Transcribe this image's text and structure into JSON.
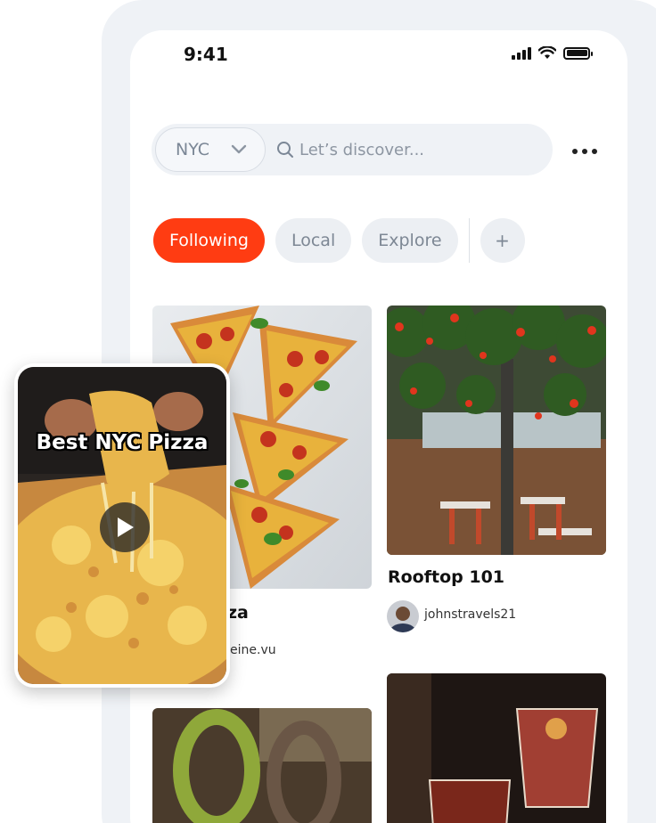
{
  "status_bar": {
    "time": "9:41"
  },
  "search": {
    "city": "NYC",
    "placeholder": "Let’s discover..."
  },
  "tabs": [
    {
      "label": "Following",
      "active": true
    },
    {
      "label": "Local",
      "active": false
    },
    {
      "label": "Explore",
      "active": false
    },
    {
      "label": "+",
      "active": false
    }
  ],
  "feed": {
    "cards": [
      {
        "title": "Rooftop 101",
        "author": "johnstravels21"
      },
      {
        "title_visible_fragment": "za",
        "author_visible_fragment": "eine.vu"
      }
    ]
  },
  "video": {
    "title": "Best NYC Pizza"
  },
  "colors": {
    "accent": "#ff3c12",
    "frame": "#eff2f6",
    "chip": "#eceff3"
  },
  "icons": [
    "chevron-down-icon",
    "search-icon",
    "more-horizontal-icon",
    "play-icon",
    "wifi-icon",
    "signal-icon",
    "battery-icon"
  ]
}
